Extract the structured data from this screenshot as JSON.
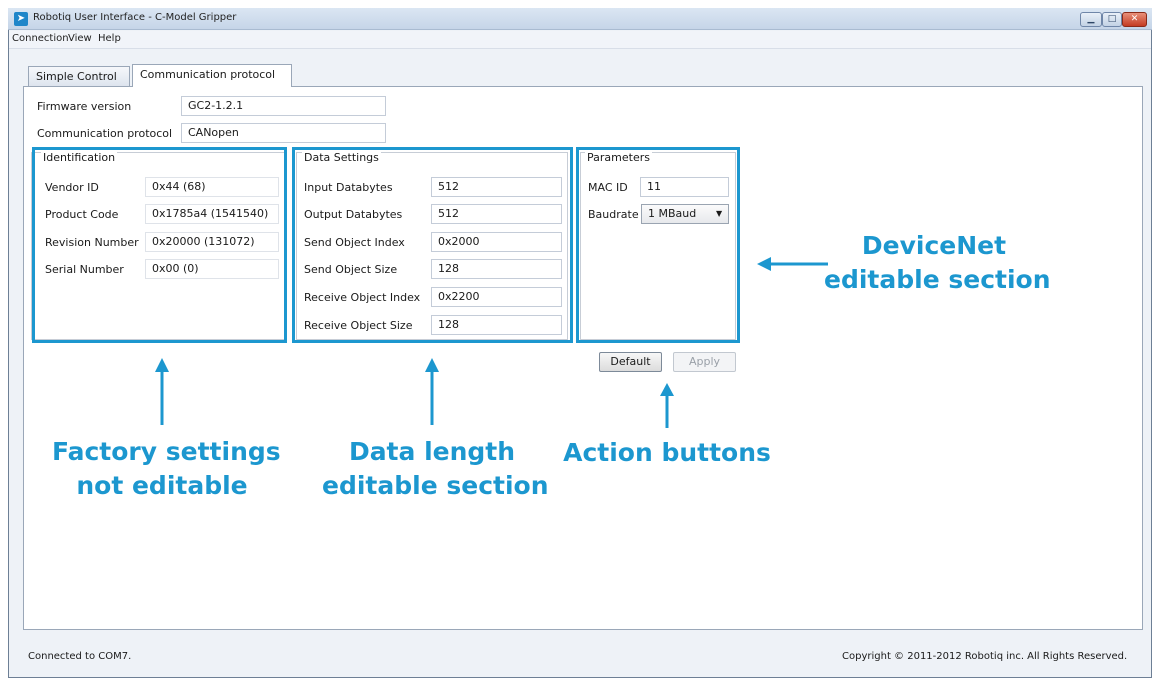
{
  "window": {
    "title": "Robotiq User Interface - C-Model Gripper",
    "icon_glyph": "➤",
    "controls": {
      "minimize": "▁",
      "maximize": "□",
      "close": "✕"
    }
  },
  "menu": [
    "Connection",
    "View",
    "Help"
  ],
  "tabs": [
    {
      "label": "Simple Control",
      "active": false
    },
    {
      "label": "Communication protocol",
      "active": true
    }
  ],
  "info": {
    "firmware_label": "Firmware version",
    "firmware_value": "GC2-1.2.1",
    "protocol_label": "Communication protocol",
    "protocol_value": "CANopen"
  },
  "identification": {
    "title": "Identification",
    "rows": [
      {
        "label": "Vendor ID",
        "value": "0x44 (68)"
      },
      {
        "label": "Product Code",
        "value": "0x1785a4 (1541540)"
      },
      {
        "label": "Revision Number",
        "value": "0x20000 (131072)"
      },
      {
        "label": "Serial Number",
        "value": "0x00 (0)"
      }
    ]
  },
  "data_settings": {
    "title": "Data Settings",
    "rows": [
      {
        "label": "Input Databytes",
        "value": "512"
      },
      {
        "label": "Output Databytes",
        "value": "512"
      },
      {
        "label": "Send Object Index",
        "value": "0x2000"
      },
      {
        "label": "Send Object Size",
        "value": "128"
      },
      {
        "label": "Receive Object Index",
        "value": "0x2200"
      },
      {
        "label": "Receive Object Size",
        "value": "128"
      }
    ]
  },
  "parameters": {
    "title": "Parameters",
    "mac_label": "MAC ID",
    "mac_value": "11",
    "baud_label": "Baudrate",
    "baud_value": "1 MBaud",
    "baud_arrow": "▼"
  },
  "buttons": {
    "default": "Default",
    "apply": "Apply",
    "apply_enabled": false
  },
  "annotations": {
    "factory_line1": "Factory settings",
    "factory_line2": "not editable",
    "data_line1": "Data length",
    "data_line2": "editable section",
    "action": "Action buttons",
    "devicenet_line1": "DeviceNet",
    "devicenet_line2": "editable section",
    "accent_color": "#1c97cf"
  },
  "status": {
    "left": "Connected to COM7.",
    "right": "Copyright © 2011-2012 Robotiq inc. All Rights Reserved."
  }
}
